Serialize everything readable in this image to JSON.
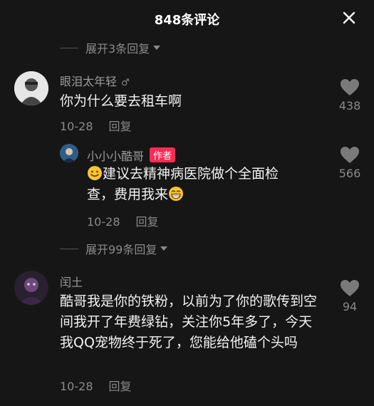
{
  "header": {
    "title": "848条评论"
  },
  "expand_top": {
    "label": "展开3条回复"
  },
  "expand_mid": {
    "label": "展开99条回复"
  },
  "comments": [
    {
      "username": "眼泪太年轻",
      "text": "你为什么要去租车啊",
      "date": "10-28",
      "reply_label": "回复",
      "likes": "438"
    },
    {
      "username": "小小小酷哥",
      "badge": "作者",
      "text_line1": "建议去精神病医院做个全面检",
      "text_line2": "查，费用我来",
      "date": "10-28",
      "reply_label": "回复",
      "likes": "566"
    },
    {
      "username": "闰土",
      "text": "酷哥我是你的铁粉，以前为了你的歌传到空间我开了年费绿钻，关注你5年多了，今天我QQ宠物终于死了，您能给他磕个头吗",
      "date": "10-28",
      "reply_label": "回复",
      "likes": "94"
    }
  ],
  "icons": {
    "close": "close-icon",
    "heart": "heart-icon",
    "caret": "caret-down-icon",
    "smile": "smile-emoji-icon",
    "grin": "grin-emoji-icon"
  }
}
